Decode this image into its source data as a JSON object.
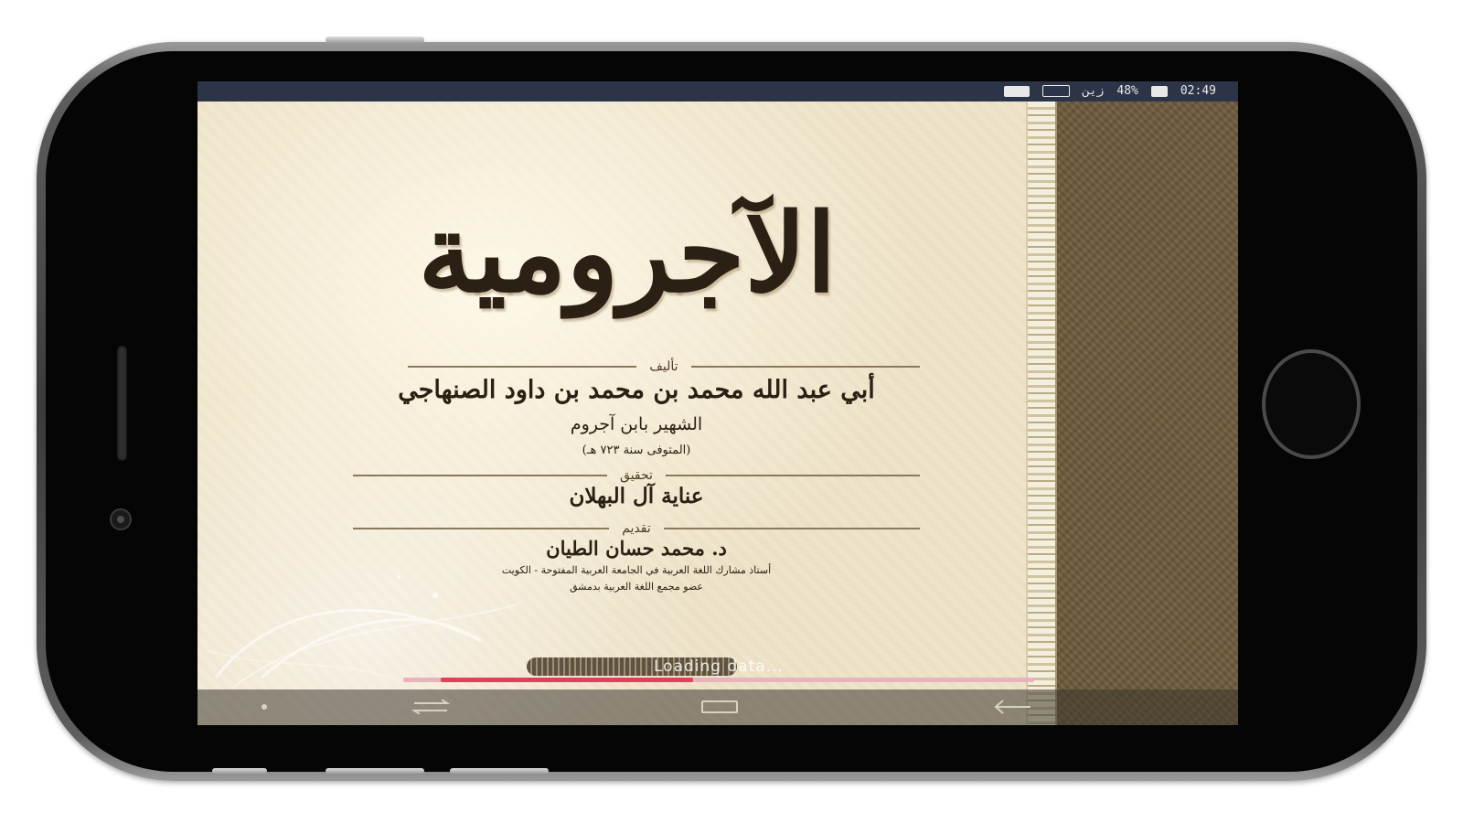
{
  "status_bar": {
    "battery_percent": "48%",
    "time": "02:49",
    "carrier": "زين"
  },
  "book": {
    "title": "الآجرومية",
    "author_label": "تأليف",
    "author_name": "أبي عبد الله محمد بن محمد بن داود الصنهاجي",
    "author_nickname": "الشهير بابن آجروم",
    "author_death": "(المتوفى سنة ٧٢٣ هـ)",
    "editor_label": "تحقيق",
    "editor_name": "عناية آل البهلان",
    "reviewer_label": "تقديم",
    "reviewer_name": "د. محمد حسان الطيان",
    "reviewer_title_1": "أستاذ مشارك اللغة العربية في الجامعة العربية المفتوحة - الكويت",
    "reviewer_title_2": "عضو مجمع اللغة العربية بدمشق"
  },
  "loading": {
    "text": "Loading data...",
    "progress": 0.4
  },
  "colors": {
    "status_bar": "#2c3547",
    "progress": "#e0405c",
    "progress_track": "#e7b3bc",
    "page": "#eee3c8",
    "leather": "#6e5b3c"
  }
}
